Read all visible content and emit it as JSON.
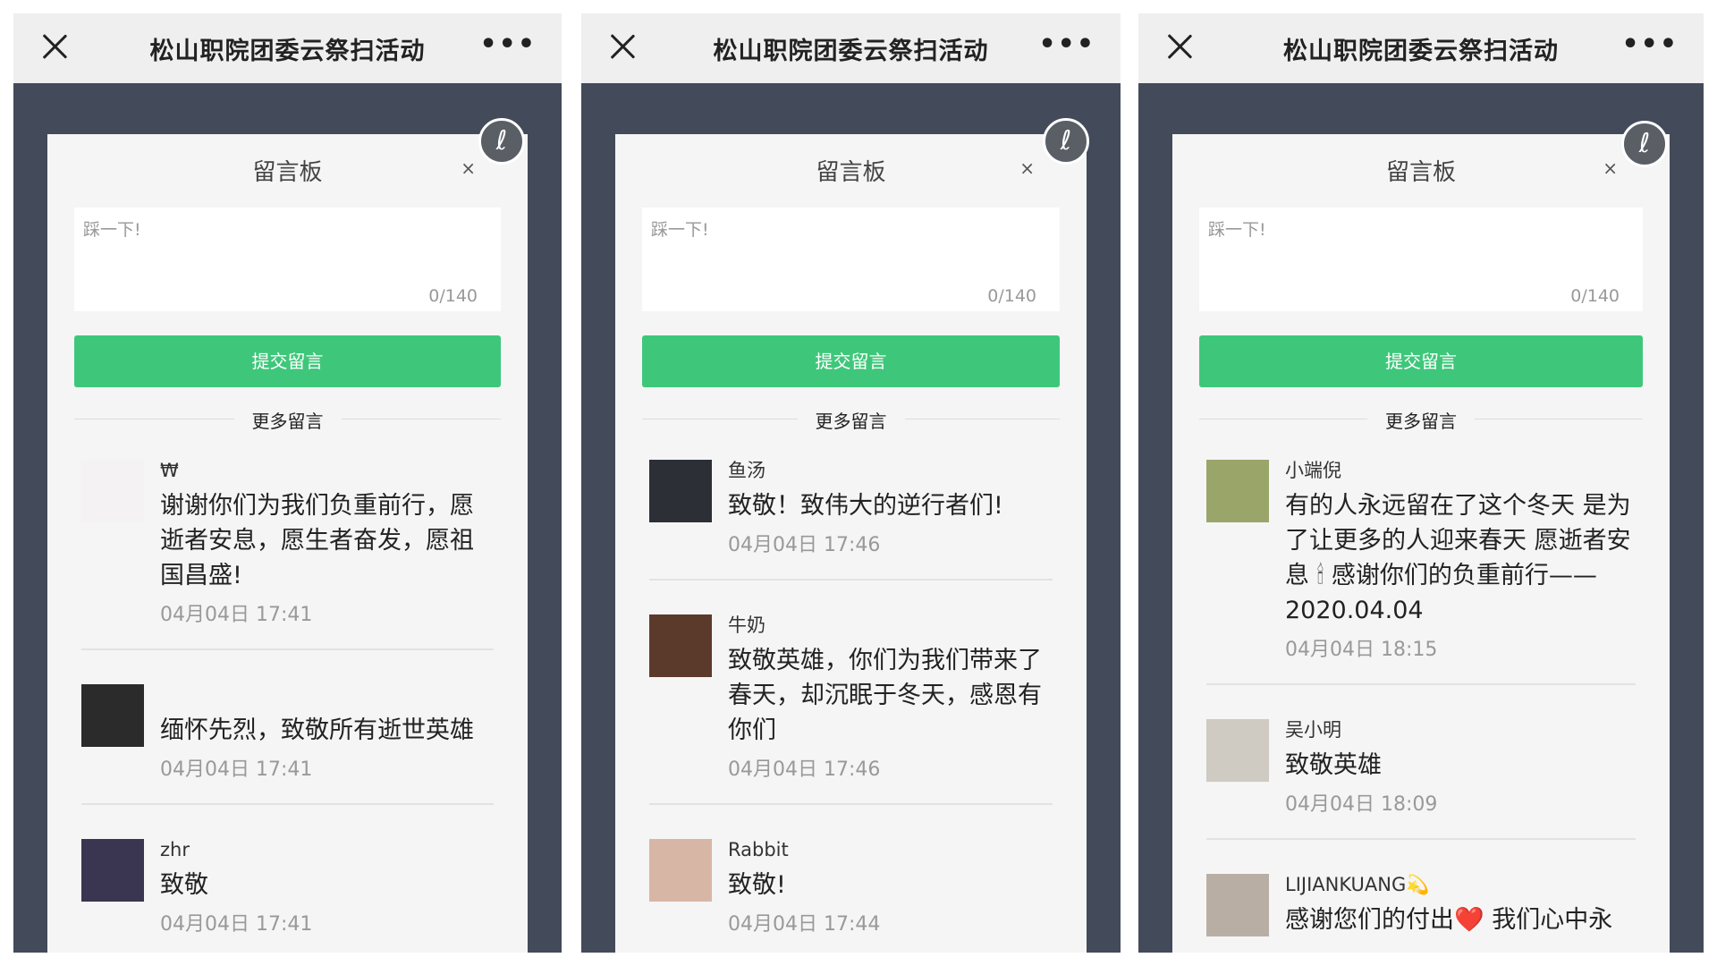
{
  "screens": [
    {
      "title": "松山职院团委云祭扫活动",
      "more": "•••",
      "board_title": "留言板",
      "board_close": "×",
      "placeholder": "踩一下!",
      "count": "0/140",
      "submit": "提交留言",
      "more_label": "更多留言",
      "comments": [
        {
          "name": "₩",
          "text": "谢谢你们为我们负重前行，愿逝者安息，愿生者奋发，愿祖国昌盛!",
          "time": "04月04日 17:41",
          "avatar_color": "#f4f2f2"
        },
        {
          "name": "",
          "text": "缅怀先烈，致敬所有逝世英雄",
          "time": "04月04日 17:41",
          "avatar_color": "#2b2b2b"
        },
        {
          "name": "zhr",
          "text": "致敬",
          "time": "04月04日 17:41",
          "avatar_color": "#3a3550"
        }
      ]
    },
    {
      "title": "松山职院团委云祭扫活动",
      "more": "•••",
      "board_title": "留言板",
      "board_close": "×",
      "placeholder": "踩一下!",
      "count": "0/140",
      "submit": "提交留言",
      "more_label": "更多留言",
      "comments": [
        {
          "name": "鱼汤",
          "text": "致敬！致伟大的逆行者们!",
          "time": "04月04日 17:46",
          "avatar_color": "#2c2f36"
        },
        {
          "name": "牛奶",
          "text": "致敬英雄，你们为我们带来了春天，却沉眠于冬天，感恩有你们",
          "time": "04月04日 17:46",
          "avatar_color": "#5b3a2c"
        },
        {
          "name": "Rabbit",
          "text": "致敬!",
          "time": "04月04日 17:44",
          "avatar_color": "#d8b6a6"
        }
      ]
    },
    {
      "title": "松山职院团委云祭扫活动",
      "more": "•••",
      "board_title": "留言板",
      "board_close": "×",
      "placeholder": "踩一下!",
      "count": "0/140",
      "submit": "提交留言",
      "more_label": "更多留言",
      "comments": [
        {
          "name": "小端倪",
          "text": "有的人永远留在了这个冬天 是为了让更多的人迎来春天 愿逝者安息 🕯 感谢你们的负重前行——2020.04.04",
          "time": "04月04日 18:15",
          "avatar_color": "#9aa56a"
        },
        {
          "name": "吴小明",
          "text": "致敬英雄",
          "time": "04月04日 18:09",
          "avatar_color": "#cfcac2"
        },
        {
          "name": "LIJIANKUANG💫",
          "text": "感谢您们的付出❤️ 我们心中永",
          "time": "",
          "avatar_color": "#b9aea4"
        }
      ]
    }
  ]
}
